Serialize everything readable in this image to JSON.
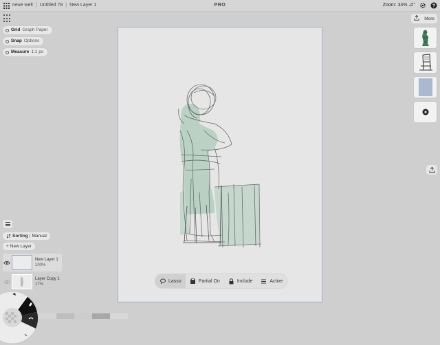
{
  "topbar": {
    "breadcrumbs": [
      "neue welt",
      "Untitled 78",
      "New Layer 1"
    ],
    "separator": "|",
    "title": "PRO",
    "zoom_label": "Zoom:",
    "zoom_value": "34% ₄0°"
  },
  "left_toolbar": {
    "grid": {
      "label": "Grid",
      "value": "Graph Paper"
    },
    "snap": {
      "label": "Snap",
      "value": "Options"
    },
    "measure": {
      "label": "Measure",
      "value": "1:1 px"
    }
  },
  "selection_tools": [
    {
      "label": "Lasso",
      "icon": "lasso-icon",
      "active": true
    },
    {
      "label": "Partial On",
      "icon": "partial-icon",
      "active": false
    },
    {
      "label": "Include",
      "icon": "lock-icon",
      "active": false
    },
    {
      "label": "Active",
      "icon": "layers-list-icon",
      "active": false
    }
  ],
  "right_panel": {
    "more_label": "More"
  },
  "layers": {
    "sorting_label": "Sorting",
    "sorting_value": "Manual",
    "new_layer_label": "New Layer",
    "items": [
      {
        "name": "New Layer 1",
        "opacity": "100%",
        "selected": true
      },
      {
        "name": "Layer Copy 1",
        "opacity": "17%",
        "selected": false
      }
    ]
  },
  "colors": {
    "canvas_border": "#9aaecb",
    "sketch_fill": "#a9cbb8",
    "swatches": [
      "#d5d5d5",
      "#bdbdbd",
      "#cccccc",
      "#a8a8a8",
      "#d8d8d8"
    ]
  }
}
